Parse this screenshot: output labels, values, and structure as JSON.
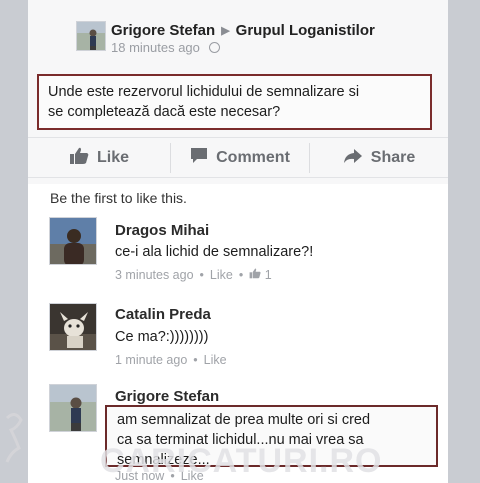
{
  "post": {
    "author": "Grigore Stefan",
    "group": "Grupul Loganistilor",
    "time": "18 minutes ago",
    "text_line1": "Unde este rezervorul lichidului de semnalizare si",
    "text_line2": "se completează dacă este necesar?"
  },
  "actions": {
    "like": "Like",
    "comment": "Comment",
    "share": "Share"
  },
  "first_like_text": "Be the first to like this.",
  "comments": [
    {
      "name": "Dragos Mihai",
      "text": "ce-i ala lichid de semnalizare?!",
      "time": "3 minutes ago",
      "like": "Like",
      "likes": "1"
    },
    {
      "name": "Catalin Preda",
      "text": "Ce ma?:))))))))",
      "time": "1 minute ago",
      "like": "Like"
    },
    {
      "name": "Grigore Stefan",
      "text_line1": "am semnalizat de prea multe ori si cred",
      "text_line2": "ca sa terminat lichidul...nu mai vrea sa",
      "text_line3": "semnalizeze...",
      "time": "Just now",
      "like": "Like"
    }
  ],
  "watermark": "CARICATURI.RO",
  "colors": {
    "highlight_border": "#7a2b2b",
    "muted_text": "#9a9da3",
    "background": "#c9ccd2"
  },
  "icons": [
    "globe-icon",
    "thumbs-up-icon",
    "comment-icon",
    "share-arrow-icon"
  ]
}
